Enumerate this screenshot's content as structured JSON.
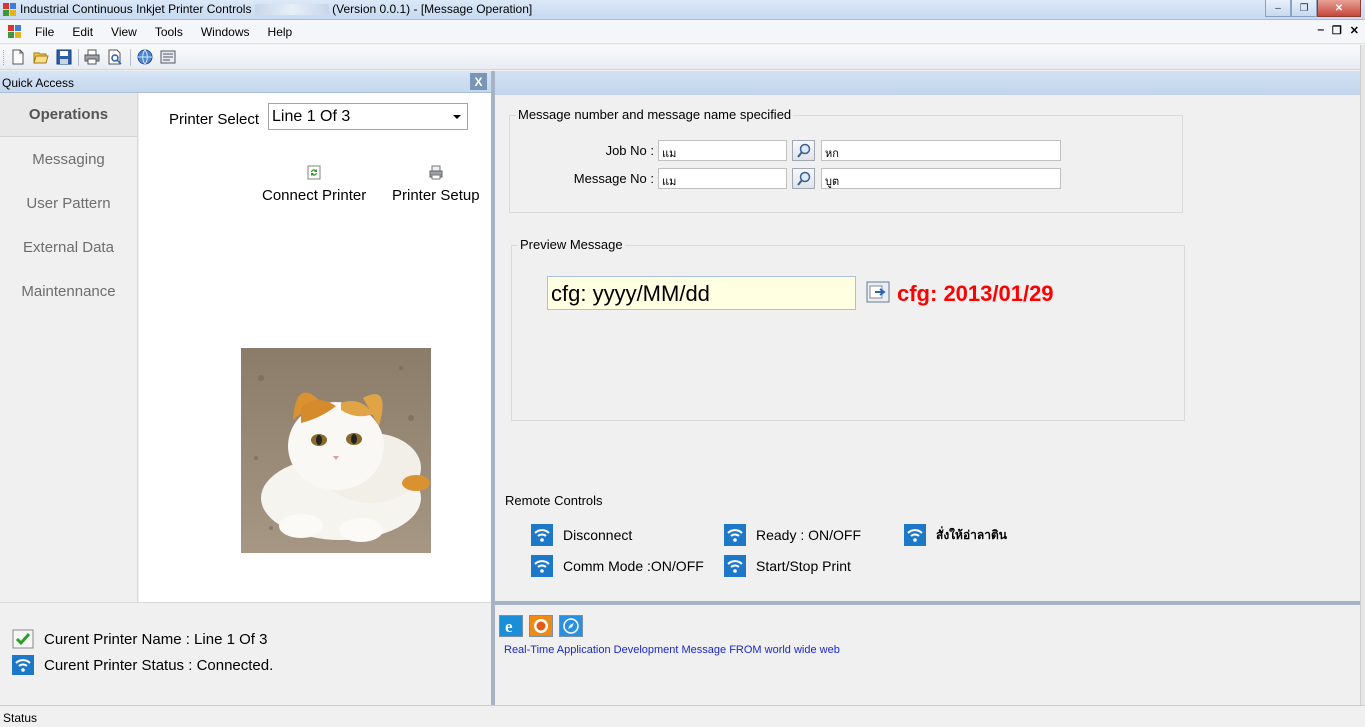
{
  "window": {
    "title_prefix": "Industrial Continuous Inkjet Printer Controls",
    "title_suffix": "(Version 0.0.1) - [Message Operation]",
    "minimize_glyph": "‒",
    "restore_glyph": "❐",
    "close_glyph": "✕"
  },
  "menu": {
    "items": [
      "File",
      "Edit",
      "View",
      "Tools",
      "Windows",
      "Help"
    ],
    "mdi_minimize": "‒",
    "mdi_restore": "❐",
    "mdi_close": "✕"
  },
  "toolbar": {
    "buttons": [
      "new-icon",
      "open-folder-icon",
      "save-icon",
      "print-icon",
      "print-preview-icon",
      "web-icon",
      "properties-icon"
    ]
  },
  "quick_access": {
    "title": "Quick Access",
    "close_glyph": "X",
    "nav": [
      {
        "label": "Operations",
        "active": true
      },
      {
        "label": "Messaging",
        "active": false
      },
      {
        "label": "User Pattern",
        "active": false
      },
      {
        "label": "External Data",
        "active": false
      },
      {
        "label": "Maintennance",
        "active": false
      }
    ],
    "printer_select_label": "Printer Select",
    "printer_select_value": "Line 1 Of 3",
    "connect_label": "Connect Printer",
    "setup_label": "Printer Setup"
  },
  "left_status": {
    "printer_name": "Curent Printer Name : Line 1 Of 3",
    "printer_status": "Curent Printer Status : Connected."
  },
  "message_spec": {
    "title": "Message number and message name specified",
    "job_label": "Job No :",
    "job_no": "แม",
    "job_name": "หก",
    "message_label": "Message No :",
    "message_no": "แม",
    "message_name": "บูต"
  },
  "preview": {
    "title": "Preview Message",
    "input": "cfg: yyyy/MM/dd",
    "result": "cfg: 2013/01/29"
  },
  "remote": {
    "title": "Remote Controls",
    "disconnect": "Disconnect",
    "ready": "Ready : ON/OFF",
    "thai_cmd": "สั่งให้อ่าลาติน",
    "comm_mode": "Comm Mode :ON/OFF",
    "start_stop": "Start/Stop Print"
  },
  "web": {
    "message": "Real-Time Application Development Message FROM world wide web",
    "icons": [
      "internet-explorer-icon",
      "firefox-icon",
      "safari-icon"
    ]
  },
  "status_bar": {
    "text": "Status"
  },
  "colors": {
    "preview_result": "#ff0000",
    "web_message": "#1c28c9",
    "wifi_blue": "#1e78c8"
  }
}
